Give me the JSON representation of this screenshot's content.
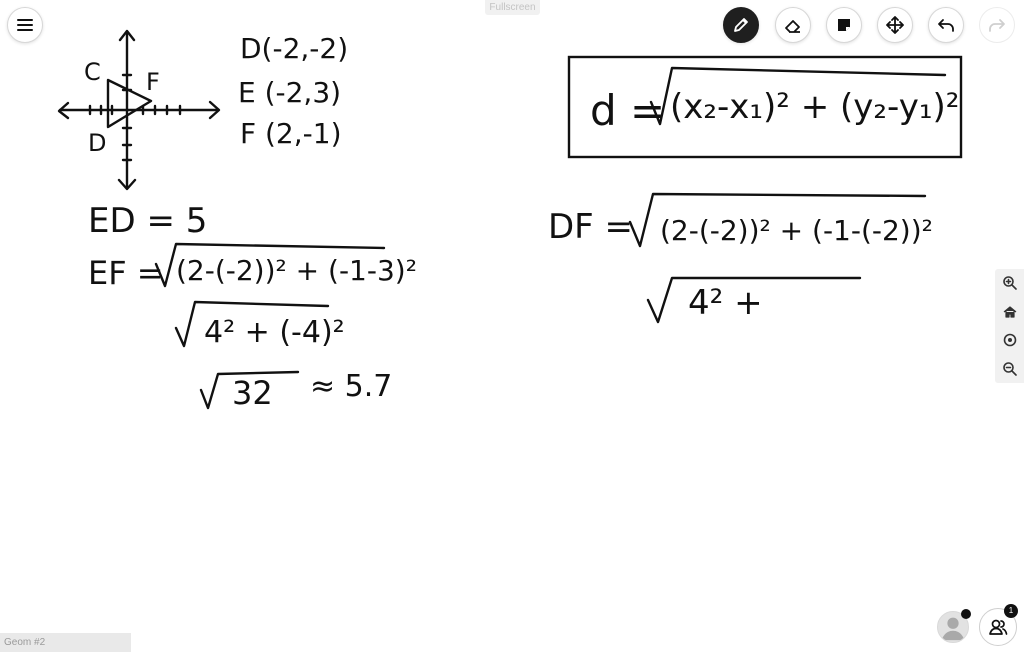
{
  "toolbar": {
    "menu_icon": "hamburger-icon",
    "tools": [
      {
        "name": "pen",
        "icon": "pencil-icon",
        "active": true
      },
      {
        "name": "eraser",
        "icon": "eraser-icon",
        "active": false
      },
      {
        "name": "sticky-note",
        "icon": "sticky-note-icon",
        "active": false
      },
      {
        "name": "move",
        "icon": "move-icon",
        "active": false
      },
      {
        "name": "undo",
        "icon": "undo-icon",
        "active": false
      },
      {
        "name": "redo",
        "icon": "redo-icon",
        "active": false
      }
    ],
    "fullscreen_label": "Fullscreen"
  },
  "zoom_panel": [
    "zoom-in-icon",
    "home-icon",
    "target-icon",
    "zoom-out-icon"
  ],
  "footer": {
    "page_label": "Geom #2",
    "participants_count": "1"
  },
  "colors": {
    "ink": "#111111",
    "active_tool_bg": "#1f1f1f",
    "panel_bg": "#f1f1f1"
  },
  "board": {
    "graph_labels": {
      "c": "C",
      "f": "F",
      "d": "D"
    },
    "points": [
      "D(-2,-2)",
      "E (-2,3)",
      "F (2,-1)"
    ],
    "left_work": [
      "ED = 5",
      "EF =",
      "(2-(-2))² + (-1-3)²",
      "4² + (-4)²",
      "32",
      "≈ 5.7"
    ],
    "formula": "d =",
    "formula_body": "(x₂-x₁)² + (y₂-y₁)²",
    "right_work": [
      "DF =",
      "(2-(-2))² + (-1-(-2))²",
      "4² +"
    ]
  }
}
